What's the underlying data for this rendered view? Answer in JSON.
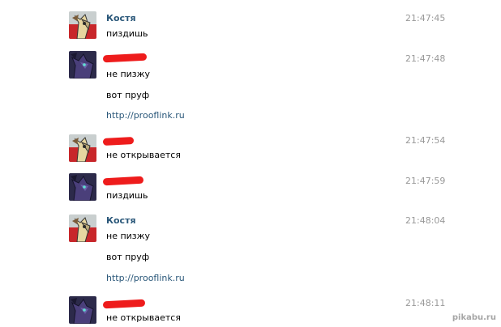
{
  "messages": [
    {
      "author": "Костя",
      "author_redacted": false,
      "avatar": "pony-avatar",
      "time": "21:47:45",
      "lines": [
        {
          "text": "пиздишь",
          "link": false
        }
      ]
    },
    {
      "author": "",
      "author_redacted": true,
      "avatar": "dark-avatar",
      "time": "21:47:48",
      "lines": [
        {
          "text": "не пизжу",
          "link": false
        },
        {
          "text": "вот пруф",
          "link": false
        },
        {
          "text": "http://prooflink.ru",
          "link": true
        }
      ]
    },
    {
      "author": "",
      "author_redacted": true,
      "avatar": "pony-avatar",
      "time": "21:47:54",
      "lines": [
        {
          "text": "не открывается",
          "link": false
        }
      ]
    },
    {
      "author": "",
      "author_redacted": true,
      "avatar": "dark-avatar",
      "time": "21:47:59",
      "lines": [
        {
          "text": "пиздишь",
          "link": false
        }
      ]
    },
    {
      "author": "Костя",
      "author_redacted": false,
      "avatar": "pony-avatar",
      "time": "21:48:04",
      "lines": [
        {
          "text": "не пизжу",
          "link": false
        },
        {
          "text": "вот пруф",
          "link": false
        },
        {
          "text": "http://prooflink.ru",
          "link": true
        }
      ]
    },
    {
      "author": "",
      "author_redacted": true,
      "avatar": "dark-avatar",
      "time": "21:48:11",
      "lines": [
        {
          "text": "не открывается",
          "link": false
        }
      ]
    }
  ],
  "watermark": "pikabu.ru",
  "colors": {
    "author": "#2b587a",
    "time": "#999999",
    "redaction": "#ee1c1c",
    "link": "#2b587a"
  }
}
